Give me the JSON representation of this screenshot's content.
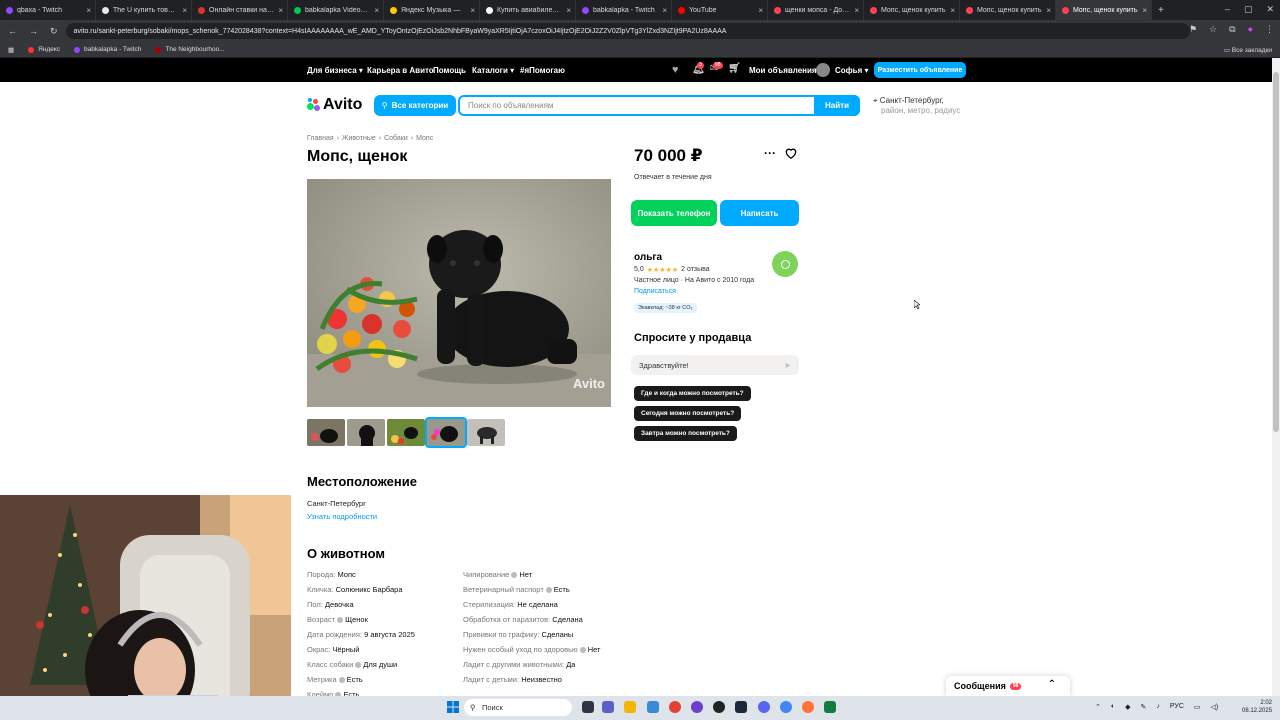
{
  "browser": {
    "tabs": [
      {
        "title": "qbaxa - Twitch",
        "color": "#9146ff"
      },
      {
        "title": "The U купить товары",
        "color": "#e8e8e8"
      },
      {
        "title": "Онлайн ставки на сп",
        "color": "#d33"
      },
      {
        "title": "babkalapka Videos - V",
        "color": "#00c853"
      },
      {
        "title": "Яндекс Музыка —",
        "color": "#ffcc00"
      },
      {
        "title": "Купить авиабилеты д",
        "color": "#ffffff"
      },
      {
        "title": "babkalapka - Twitch",
        "color": "#9146ff"
      },
      {
        "title": "YouTube",
        "color": "#ff0000"
      },
      {
        "title": "щенки мопса - Дома",
        "color": "#ff4053"
      },
      {
        "title": "Мопс, щенок купить",
        "color": "#ff4053"
      },
      {
        "title": "Мопс, щенок купить",
        "color": "#ff4053"
      },
      {
        "title": "Мопс, щенок купить",
        "color": "#ff4053",
        "active": true
      }
    ],
    "url": "avito.ru/sankt-peterburg/sobaki/mops_schenok_7742028438?context=H4sIAAAAAAAA_wE_AMD_YToyOntzOjEzOiJsb2NhbFByaW9yaXR5IjtiOjA7czoxOiJ4IjtzOjE2OiJ2Z2V0ZlpVTg3YlZxd3NZIjt9PA2Uz8AAAA",
    "bookmarks": [
      "Яндекс",
      "babkalapka - Twitch",
      "The Neighbourhoo..."
    ],
    "all_bookmarks": "Все закладки"
  },
  "topnav": {
    "business": "Для бизнеса",
    "career": "Карьера в Авито",
    "help": "Помощь",
    "catalogs": "Каталоги",
    "help_tag": "#яПомогаю",
    "notif_badge": "3",
    "msg_badge": "98",
    "my_ads": "Мои объявления",
    "user": "Софья",
    "post_ad": "Разместить объявление"
  },
  "header": {
    "logo": "Avito",
    "all_categories": "Все категории",
    "search_placeholder": "Поиск по объявлениям",
    "search_button": "Найти",
    "city": "Санкт-Петербург,",
    "city_sub": "район, метро, радиус"
  },
  "breadcrumbs": [
    "Главная",
    "Животные",
    "Собаки",
    "Мопс"
  ],
  "listing": {
    "title": "Мопс, щенок",
    "price": "70 000 ₽",
    "reply_time": "Отвечает в течение дня",
    "show_phone": "Показать телефон",
    "write": "Написать",
    "watermark": "Avito"
  },
  "seller": {
    "name": "ольга",
    "rating": "5,0",
    "stars": "★★★★★",
    "reviews": "2 отзыва",
    "info": "Частное лицо · На Авито с 2010 года",
    "subscribe": "Подписаться",
    "eco": "Экавклад: ~38 кг CO₂"
  },
  "ask": {
    "heading": "Спросите у продавца",
    "input_value": "Здравствуйте!",
    "quick": [
      "Где и когда можно посмотреть?",
      "Сегодня можно посмотреть?",
      "Завтра можно посмотреть?"
    ]
  },
  "location": {
    "heading": "Местоположение",
    "city": "Санкт-Петербург",
    "more": "Узнать подробности"
  },
  "about": {
    "heading": "О животном",
    "left": [
      {
        "k": "Порода:",
        "v": "Мопс",
        "q": false
      },
      {
        "k": "Кличка:",
        "v": "Солюникс Барбара",
        "q": false
      },
      {
        "k": "Пол:",
        "v": "Девочка",
        "q": false
      },
      {
        "k": "Возраст",
        "v": "Щенок",
        "q": true
      },
      {
        "k": "Дата рождения:",
        "v": "9 августа 2025",
        "q": false
      },
      {
        "k": "Окрас:",
        "v": "Чёрный",
        "q": false
      },
      {
        "k": "Класс собаки",
        "v": "Для души",
        "q": true
      },
      {
        "k": "Метрика",
        "v": "Есть",
        "q": true
      },
      {
        "k": "Клеймо",
        "v": "Есть",
        "q": true
      }
    ],
    "right": [
      {
        "k": "Чипирование",
        "v": "Нет",
        "q": true
      },
      {
        "k": "Ветеринарный паспорт",
        "v": "Есть",
        "q": true
      },
      {
        "k": "Стерилизация:",
        "v": "Не сделана",
        "q": false
      },
      {
        "k": "Обработка от паразитов:",
        "v": "Сделана",
        "q": false
      },
      {
        "k": "Прививки по графику:",
        "v": "Сделаны",
        "q": false
      },
      {
        "k": "Нужен особый уход по здоровью",
        "v": "Нет",
        "q": true
      },
      {
        "k": "Ладит с другими животными:",
        "v": "Да",
        "q": false
      },
      {
        "k": "Ладит с детьми:",
        "v": "Неизвестно",
        "q": false
      }
    ]
  },
  "messages_widget": {
    "label": "Сообщения",
    "badge": "98"
  },
  "taskbar": {
    "search": "Поиск",
    "lang": "РУС",
    "time": "2:02",
    "date": "08.12.2025"
  }
}
